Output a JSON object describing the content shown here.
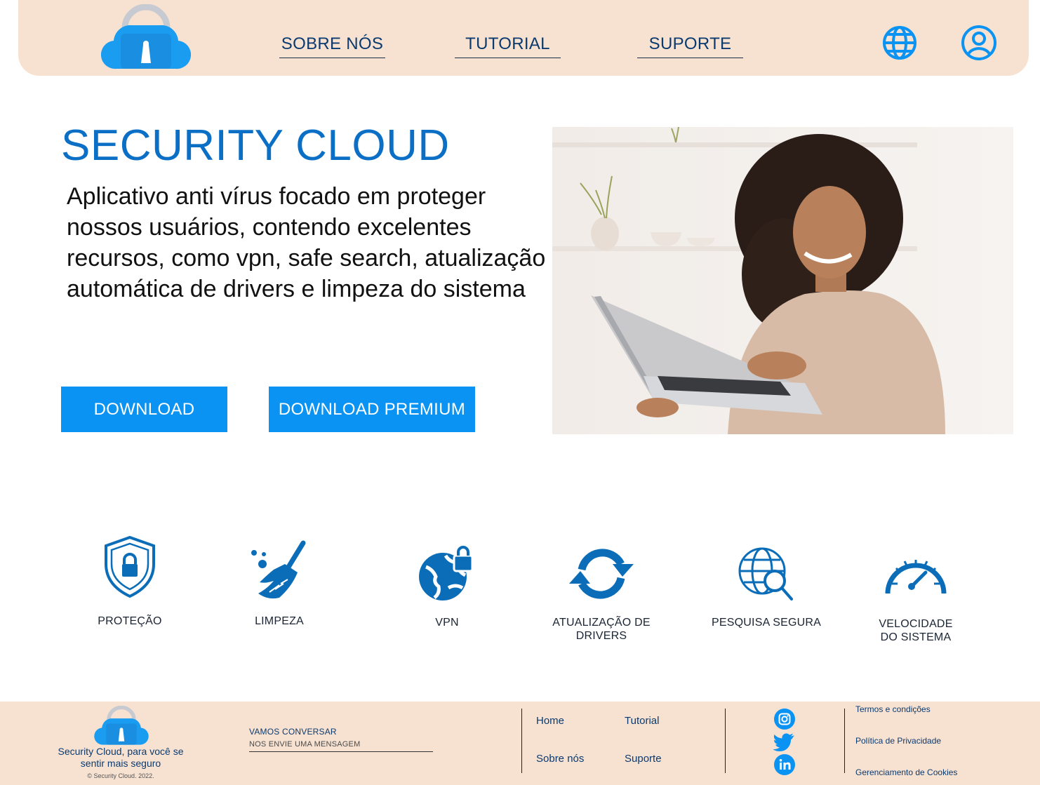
{
  "colors": {
    "brand_blue": "#0a93f2",
    "title_blue": "#0b6fc6",
    "icon_blue": "#0b6db8",
    "header_bg": "#f7e2d2",
    "footer_bg": "#f7e2d2"
  },
  "header": {
    "logo_icon": "lock-cloud-icon",
    "nav": [
      {
        "label": "SOBRE NÓS"
      },
      {
        "label": "TUTORIAL"
      },
      {
        "label": "SUPORTE"
      }
    ],
    "icons": [
      "globe-icon",
      "user-icon"
    ]
  },
  "hero": {
    "title": "SECURITY CLOUD",
    "description": "Aplicativo anti vírus focado em proteger nossos usuários, contendo excelentes recursos,  como vpn, safe search, atualização automática de drivers e limpeza do sistema",
    "buttons": {
      "download": "DOWNLOAD",
      "premium": "DOWNLOAD PREMIUM"
    },
    "image": "woman-with-laptop-photo"
  },
  "features": [
    {
      "label": "PROTEÇÃO",
      "icon": "shield-lock-icon"
    },
    {
      "label": "LIMPEZA",
      "icon": "broom-icon"
    },
    {
      "label": "VPN",
      "icon": "globe-lock-icon"
    },
    {
      "label": "ATUALIZAÇÃO DE DRIVERS",
      "icon": "refresh-icon"
    },
    {
      "label": "PESQUISA SEGURA",
      "icon": "globe-search-icon"
    },
    {
      "label": "VELOCIDADE DO SISTEMA",
      "icon": "speedometer-icon"
    }
  ],
  "footer": {
    "tagline": "Security Cloud, para você se sentir mais seguro",
    "copyright": "© Security Cloud. 2022.",
    "contact": {
      "title": "VAMOS CONVERSAR",
      "placeholder": "NOS ENVIE UMA MENSAGEM"
    },
    "links": {
      "home": "Home",
      "tutorial": "Tutorial",
      "sobre": "Sobre nós",
      "suporte": "Suporte"
    },
    "social": [
      "instagram-icon",
      "twitter-icon",
      "linkedin-icon"
    ],
    "legal": {
      "terms": "Termos e condições",
      "privacy": "Política de Privacidade",
      "cookies": "Gerenciamento de Cookies"
    }
  }
}
